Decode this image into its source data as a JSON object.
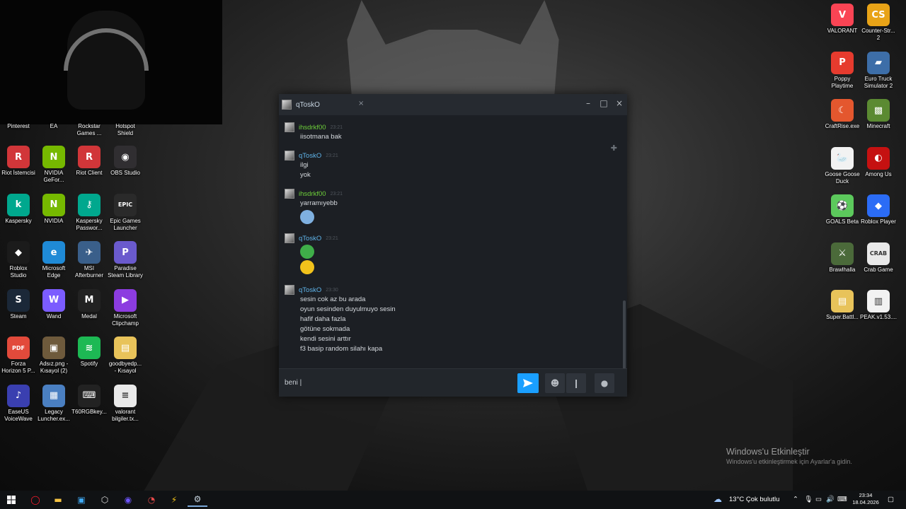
{
  "desktop": {
    "top_labels": [
      "Pinterest",
      "EA",
      "Rockstar\nGames ...",
      "Hotspot\nShield"
    ],
    "left_icons": [
      {
        "label": "Riot İstemcisi",
        "color": "#d13639",
        "glyph": "R"
      },
      {
        "label": "NVIDIA\nGeFor...",
        "color": "#76b900",
        "glyph": "N"
      },
      {
        "label": "Riot Client",
        "color": "#d13639",
        "glyph": "R"
      },
      {
        "label": "OBS Studio",
        "color": "#302e31",
        "glyph": "◉"
      },
      {
        "label": "Kaspersky",
        "color": "#00a88e",
        "glyph": "k"
      },
      {
        "label": "NVIDIA",
        "color": "#76b900",
        "glyph": "N"
      },
      {
        "label": "Kaspersky\nPasswor...",
        "color": "#00a88e",
        "glyph": "⚷"
      },
      {
        "label": "Epic Games\nLauncher",
        "color": "#2a2a2a",
        "glyph": "EPIC"
      },
      {
        "label": "Roblox\nStudio",
        "color": "#1b1b1b",
        "glyph": "◆"
      },
      {
        "label": "Microsoft\nEdge",
        "color": "#1f8ad6",
        "glyph": "e"
      },
      {
        "label": "MSI\nAfterburner",
        "color": "#3a5f8a",
        "glyph": "✈"
      },
      {
        "label": "Paradise\nSteam Library",
        "color": "#6a5acd",
        "glyph": "P"
      },
      {
        "label": "Steam",
        "color": "#1b2838",
        "glyph": "S"
      },
      {
        "label": "Wand",
        "color": "#7b5cff",
        "glyph": "W"
      },
      {
        "label": "Medal",
        "color": "#222222",
        "glyph": "M"
      },
      {
        "label": "Microsoft\nClipchamp",
        "color": "#8c3ce0",
        "glyph": "▶"
      },
      {
        "label": "Forza\nHorizon 5 P...",
        "color": "#e24a3b",
        "glyph": "PDF"
      },
      {
        "label": "Adsız.png -\nKısayol (2)",
        "color": "#6e5a3c",
        "glyph": "▣"
      },
      {
        "label": "Spotify",
        "color": "#1db954",
        "glyph": "≋"
      },
      {
        "label": "goodbyedp...\n- Kısayol",
        "color": "#e8c35a",
        "glyph": "▤"
      },
      {
        "label": "EaseUS\nVoiceWave",
        "color": "#3a3fb0",
        "glyph": "♪"
      },
      {
        "label": "Legacy\nLuncher.ex...",
        "color": "#4a7fc1",
        "glyph": "▦"
      },
      {
        "label": "T60RGBkey...",
        "color": "#222222",
        "glyph": "⌨"
      },
      {
        "label": "valorant\nbilgiler.tx...",
        "color": "#e9e9e9",
        "glyph": "≡"
      }
    ],
    "right_icons": [
      {
        "label": "VALORANT",
        "color": "#fa4454",
        "glyph": "V"
      },
      {
        "label": "Counter-Str...\n2",
        "color": "#e8a317",
        "glyph": "CS"
      },
      {
        "label": "Poppy\nPlaytime",
        "color": "#e63b2e",
        "glyph": "P"
      },
      {
        "label": "Euro Truck\nSimulator 2",
        "color": "#3d6ea8",
        "glyph": "▰"
      },
      {
        "label": "CraftRise.exe",
        "color": "#e4572e",
        "glyph": "☾"
      },
      {
        "label": "Minecraft",
        "color": "#5b8a32",
        "glyph": "▩"
      },
      {
        "label": "Goose Goose\nDuck",
        "color": "#f2f2f2",
        "glyph": "🦢"
      },
      {
        "label": "Among Us",
        "color": "#c51111",
        "glyph": "◐"
      },
      {
        "label": "GOALS Beta",
        "color": "#5cc95c",
        "glyph": "⚽"
      },
      {
        "label": "Roblox Player",
        "color": "#2b6cf6",
        "glyph": "◆"
      },
      {
        "label": "Brawlhalla",
        "color": "#4b6a3a",
        "glyph": "⚔"
      },
      {
        "label": "Crab Game",
        "color": "#e9e9e9",
        "glyph": "CRAB"
      },
      {
        "label": "Super.Battl...",
        "color": "#e8c35a",
        "glyph": "▤"
      },
      {
        "label": "PEAK.v1.53....",
        "color": "#f2f2f2",
        "glyph": "▥"
      }
    ]
  },
  "chat": {
    "tab_name": "qToskO",
    "messages": [
      {
        "name": "ihsdrkf00",
        "name_color": "#6dcf3a",
        "time": "23:21",
        "lines": [
          "iisotmana bak"
        ],
        "emojis": []
      },
      {
        "name": "qToskO",
        "name_color": "#5fb4ea",
        "time": "23:21",
        "lines": [
          "ilgi",
          "yok"
        ],
        "emojis": []
      },
      {
        "name": "ihsdrkf00",
        "name_color": "#6dcf3a",
        "time": "23:21",
        "lines": [
          "yarramıyebb"
        ],
        "emojis": [
          "#7fb0e0"
        ]
      },
      {
        "name": "qToskO",
        "name_color": "#5fb4ea",
        "time": "23:21",
        "lines": [],
        "emojis": [
          "#3fae49",
          "#f2c21b"
        ]
      },
      {
        "name": "qToskO",
        "name_color": "#5fb4ea",
        "time": "23:30",
        "lines": [
          "sesin cok az bu arada",
          "oyun sesinden duyulmuyo sesin",
          "hafif daha fazla",
          "götüne sokmada",
          "kendi sesini arttır",
          "f3 basip random silahı kapa"
        ],
        "emojis": []
      }
    ],
    "input_value": "beni |"
  },
  "watermark": {
    "title": "Windows'u Etkinleştir",
    "subtitle": "Windows'u etkinleştirmek için Ayarlar'a gidin."
  },
  "taskbar": {
    "weather": "13°C  Çok bulutlu",
    "time": "23:34",
    "date": "18.04.2026",
    "accent": "#1a9fff"
  }
}
